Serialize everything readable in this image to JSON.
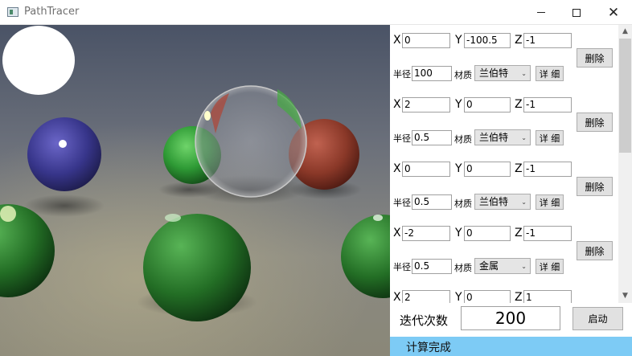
{
  "window": {
    "title": "PathTracer",
    "minimize_glyph": "",
    "maximize_glyph": "",
    "close_glyph": "✕"
  },
  "labels": {
    "x": "X",
    "y": "Y",
    "z": "Z",
    "radius": "半径",
    "material": "材质",
    "delete": "删除",
    "detail": "详 细"
  },
  "spheres": [
    {
      "x": "0",
      "y": "-100.5",
      "z": "-1",
      "radius": "100",
      "material": "兰伯特"
    },
    {
      "x": "2",
      "y": "0",
      "z": "-1",
      "radius": "0.5",
      "material": "兰伯特"
    },
    {
      "x": "0",
      "y": "0",
      "z": "-1",
      "radius": "0.5",
      "material": "兰伯特"
    },
    {
      "x": "-2",
      "y": "0",
      "z": "-1",
      "radius": "0.5",
      "material": "金属"
    },
    {
      "x": "2",
      "y": "0",
      "z": "1"
    }
  ],
  "iterations": {
    "label": "迭代次数",
    "value": "200"
  },
  "start_button": "启动",
  "status": "计算完成",
  "scroll": {
    "up_glyph": "▲",
    "down_glyph": "▼"
  }
}
